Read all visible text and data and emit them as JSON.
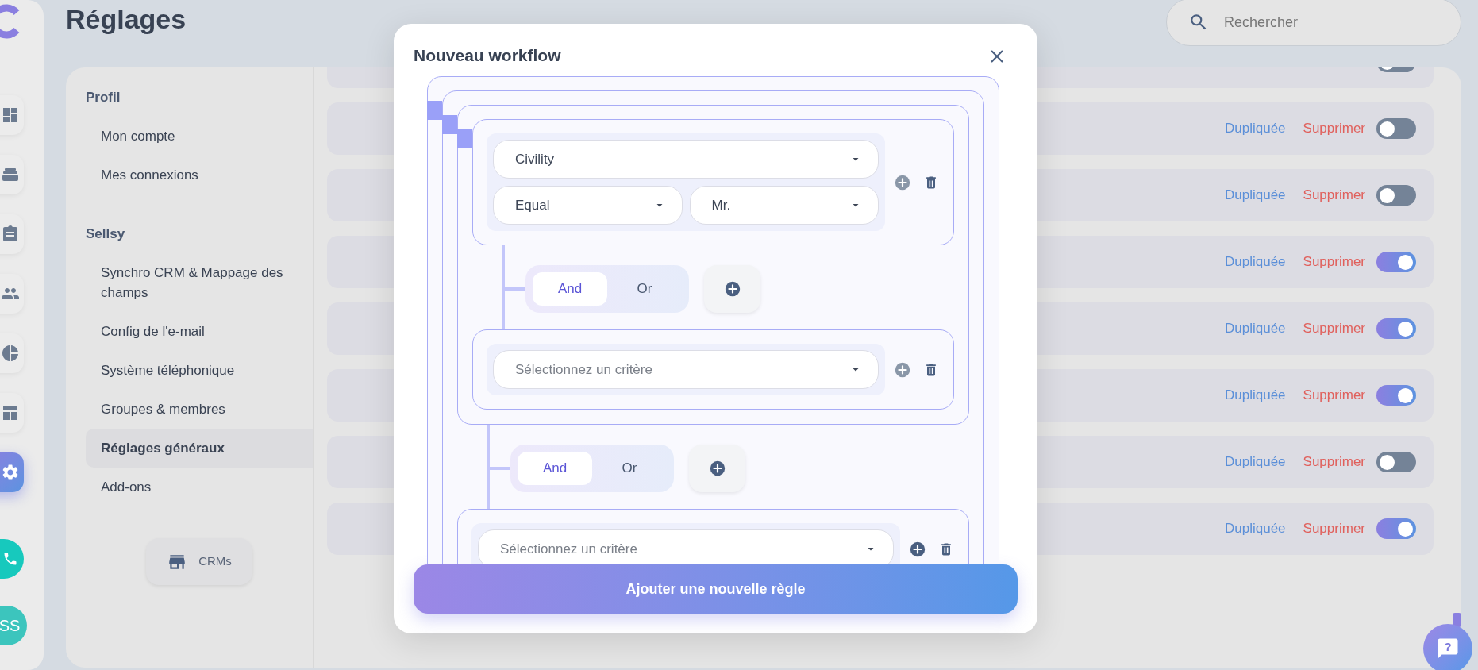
{
  "nav_rail": {
    "items": [
      {
        "selected": false
      },
      {
        "selected": false
      },
      {
        "selected": false
      },
      {
        "selected": false
      },
      {
        "selected": false
      },
      {
        "selected": false
      },
      {
        "selected": true
      }
    ],
    "avatar": {
      "initials": "SS"
    }
  },
  "page": {
    "title": "Réglages"
  },
  "search": {
    "placeholder": "Rechercher"
  },
  "settings_nav": {
    "sections": [
      {
        "heading": "Profil",
        "items": [
          {
            "label": "Mon compte",
            "selected": false
          },
          {
            "label": "Mes connexions",
            "selected": false
          }
        ]
      },
      {
        "heading": "Sellsy",
        "items": [
          {
            "label": "Synchro CRM & Mappage des champs",
            "selected": false
          },
          {
            "label": "Config de l'e-mail",
            "selected": false
          },
          {
            "label": "Système téléphonique",
            "selected": false
          },
          {
            "label": "Groupes & membres",
            "selected": false
          },
          {
            "label": "Réglages généraux",
            "selected": true
          },
          {
            "label": "Add-ons",
            "selected": false
          }
        ]
      }
    ],
    "crm_button": "CRMs"
  },
  "workflow_rows": [
    {
      "on": false
    },
    {
      "duplicate": "Dupliquée",
      "delete": "Supprimer",
      "on": false
    },
    {
      "duplicate": "Dupliquée",
      "delete": "Supprimer",
      "on": false
    },
    {
      "duplicate": "Dupliquée",
      "delete": "Supprimer",
      "on": true
    },
    {
      "duplicate": "Dupliquée",
      "delete": "Supprimer",
      "on": true
    },
    {
      "duplicate": "Dupliquée",
      "delete": "Supprimer",
      "on": true
    },
    {
      "duplicate": "Dupliquée",
      "delete": "Supprimer",
      "on": false
    },
    {
      "duplicate": "Dupliquée",
      "delete": "Supprimer",
      "on": true
    }
  ],
  "modal": {
    "title": "Nouveau workflow",
    "tree": {
      "kind": "group",
      "children": [
        {
          "kind": "group",
          "children": [
            {
              "kind": "group",
              "children": [
                {
                  "kind": "condition",
                  "field": "Civility",
                  "operator": "Equal",
                  "value": "Mr.",
                  "add_disabled": true
                },
                {
                  "kind": "operator",
                  "options": [
                    {
                      "label": "And",
                      "selected": true
                    },
                    {
                      "label": "Or",
                      "selected": false
                    }
                  ]
                },
                {
                  "kind": "condition",
                  "placeholder": "Sélectionnez un critère",
                  "add_disabled": true
                }
              ]
            },
            {
              "kind": "operator",
              "options": [
                {
                  "label": "And",
                  "selected": true
                },
                {
                  "label": "Or",
                  "selected": false
                }
              ]
            },
            {
              "kind": "condition",
              "placeholder": "Sélectionnez un critère",
              "add_disabled": false
            }
          ]
        }
      ]
    },
    "add_rule_button": "Ajouter une nouvelle règle"
  },
  "help_button": {
    "label": "?"
  }
}
